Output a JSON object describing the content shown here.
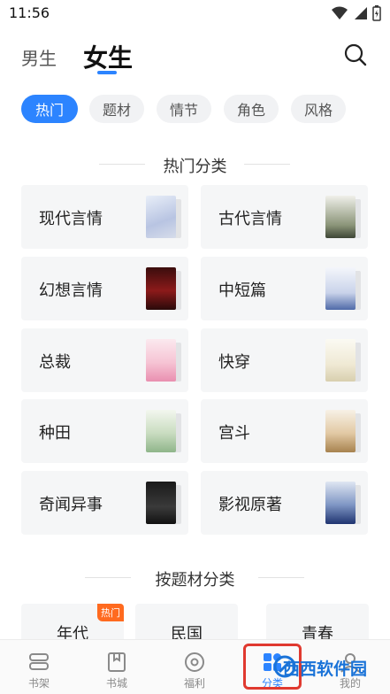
{
  "status_bar": {
    "time": "11:56"
  },
  "top_tabs": {
    "male": "男生",
    "female": "女生"
  },
  "filters": [
    "热门",
    "题材",
    "情节",
    "角色",
    "风格"
  ],
  "sections": {
    "hot_title": "热门分类",
    "theme_title": "按题材分类"
  },
  "hot_categories": [
    {
      "label": "现代言情"
    },
    {
      "label": "古代言情"
    },
    {
      "label": "幻想言情"
    },
    {
      "label": "中短篇"
    },
    {
      "label": "总裁"
    },
    {
      "label": "快穿"
    },
    {
      "label": "种田"
    },
    {
      "label": "宫斗"
    },
    {
      "label": "奇闻异事"
    },
    {
      "label": "影视原著"
    }
  ],
  "theme_categories": [
    {
      "label": "年代",
      "badge": "热门"
    },
    {
      "label": "民国"
    },
    {
      "label": "青春"
    }
  ],
  "bottom_nav": [
    {
      "label": "书架"
    },
    {
      "label": "书城"
    },
    {
      "label": "福利"
    },
    {
      "label": "分类"
    },
    {
      "label": "我的"
    }
  ],
  "watermark": "西西软件园",
  "colors": {
    "accent": "#2c84ff",
    "badge": "#ff6a1f",
    "highlight": "#e0392f"
  }
}
